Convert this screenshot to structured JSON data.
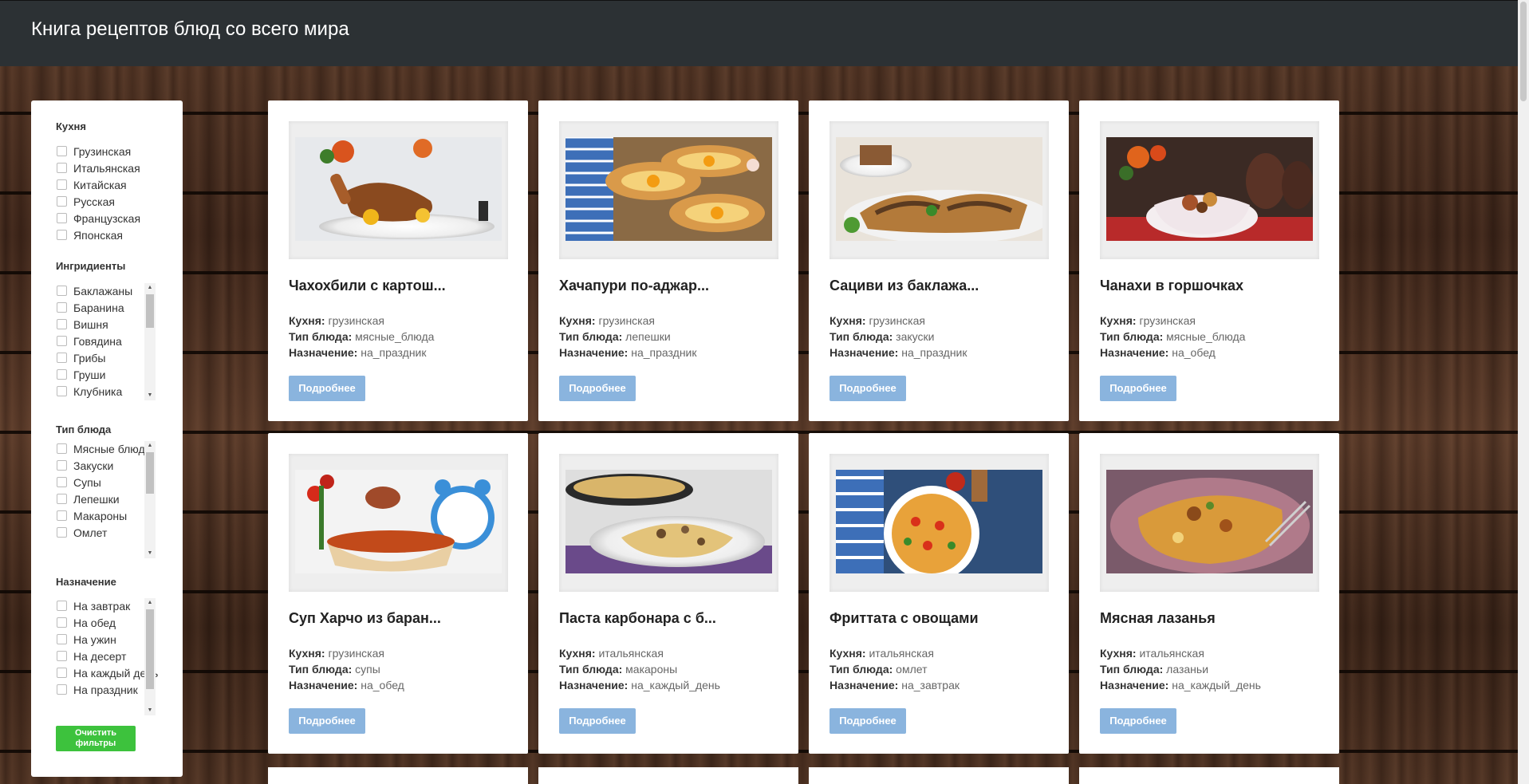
{
  "header": {
    "title": "Книга рецептов блюд со всего мира"
  },
  "filters": {
    "cuisine": {
      "title": "Кухня",
      "items": [
        "Грузинская",
        "Итальянская",
        "Китайская",
        "Русская",
        "Французская",
        "Японская"
      ]
    },
    "ingredients": {
      "title": "Ингридиенты",
      "items": [
        "Баклажаны",
        "Баранина",
        "Вишня",
        "Говядина",
        "Грибы",
        "Груши",
        "Клубника"
      ]
    },
    "dish_type": {
      "title": "Тип блюда",
      "items": [
        "Мясные блюда",
        "Закуски",
        "Супы",
        "Лепешки",
        "Макароны",
        "Омлет"
      ]
    },
    "purpose": {
      "title": "Назначение",
      "items": [
        "На завтрак",
        "На обед",
        "На ужин",
        "На десерт",
        "На каждый день",
        "На праздник"
      ]
    },
    "clear_label": "Очистить фильтры"
  },
  "labels": {
    "cuisine": "Кухня:",
    "type": "Тип блюда:",
    "purpose": "Назначение:",
    "more": "Подробнее"
  },
  "recipes": [
    {
      "name": "Чахохбили с картош...",
      "cuisine": "грузинская",
      "type": "мясные_блюда",
      "purpose": "на_праздник"
    },
    {
      "name": "Хачапури по-аджар...",
      "cuisine": "грузинская",
      "type": "лепешки",
      "purpose": "на_праздник"
    },
    {
      "name": "Сациви из баклажа...",
      "cuisine": "грузинская",
      "type": "закуски",
      "purpose": "на_праздник"
    },
    {
      "name": "Чанахи в горшочках",
      "cuisine": "грузинская",
      "type": "мясные_блюда",
      "purpose": "на_обед"
    },
    {
      "name": "Суп Харчо из баран...",
      "cuisine": "грузинская",
      "type": "супы",
      "purpose": "на_обед"
    },
    {
      "name": "Паста карбонара с б...",
      "cuisine": "итальянская",
      "type": "макароны",
      "purpose": "на_каждый_день"
    },
    {
      "name": "Фриттата с овощами",
      "cuisine": "итальянская",
      "type": "омлет",
      "purpose": "на_завтрак"
    },
    {
      "name": "Мясная лазанья",
      "cuisine": "итальянская",
      "type": "лазаньи",
      "purpose": "на_каждый_день"
    }
  ],
  "colors": {
    "header_bg": "#2c3134",
    "more_button": "#8ab4de",
    "clear_button": "#3dc23d"
  }
}
